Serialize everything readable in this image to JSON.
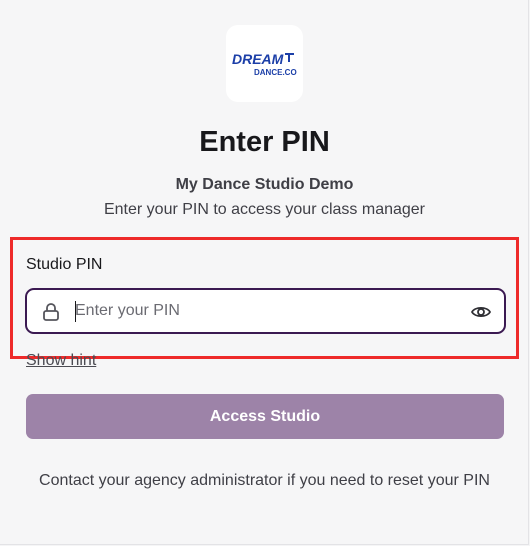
{
  "logo": {
    "line1": "DREAM",
    "line2": "DANCE.CO",
    "color": "#1c3fa8"
  },
  "header": {
    "title": "Enter PIN",
    "studio_name": "My Dance Studio Demo",
    "subtitle": "Enter your PIN to access your class manager"
  },
  "form": {
    "label": "Studio PIN",
    "pin_value": "",
    "pin_placeholder": "Enter your PIN",
    "hint_link": "Show hint",
    "submit_label": "Access Studio"
  },
  "footer": {
    "note": "Contact your agency administrator if you need to reset your PIN"
  },
  "icons": {
    "field_left": "lock-icon",
    "field_right": "eye-icon"
  },
  "colors": {
    "accent": "#9d83a8",
    "focus_border": "#3b1a52",
    "annotation": "#ee2a2a",
    "logo_blue": "#1c3fa8"
  }
}
